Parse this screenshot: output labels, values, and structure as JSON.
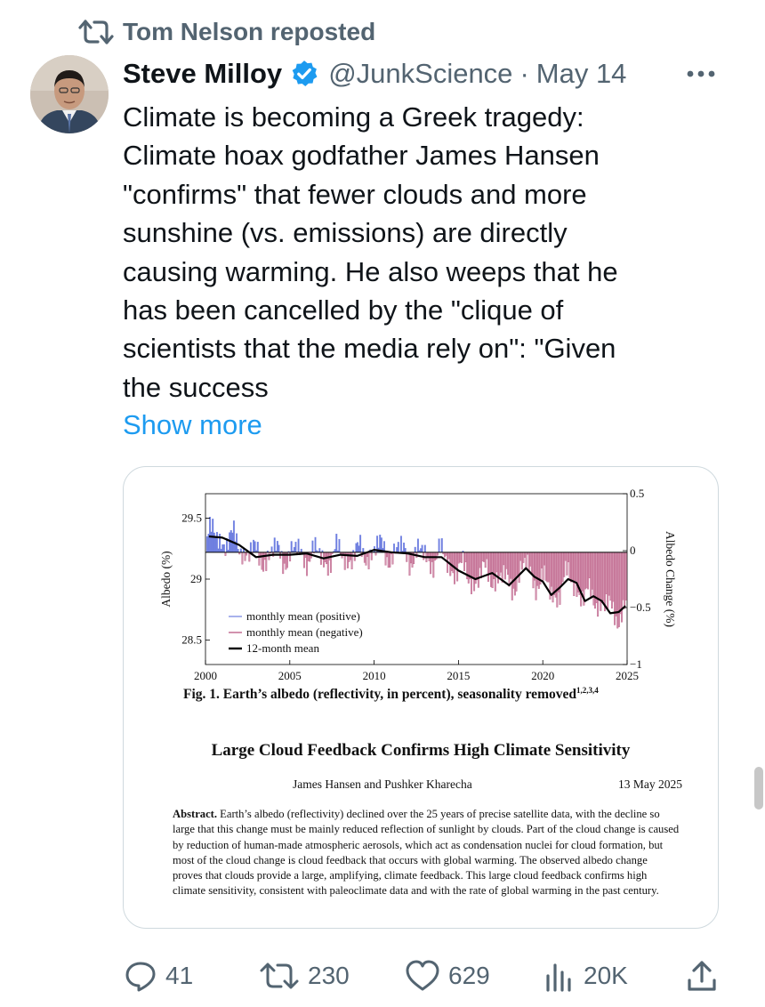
{
  "repost": {
    "text": "Tom Nelson reposted"
  },
  "tweet": {
    "author": {
      "name": "Steve Milloy",
      "handle": "@JunkScience",
      "date": "May 14",
      "verified": true
    },
    "separator": "·",
    "text": "Climate is becoming a Greek tragedy:\nClimate hoax godfather James Hansen\n\"confirms\" that fewer clouds and more\nsunshine (vs. emissions) are directly\ncausing warming. He also weeps that he\nhas been cancelled by the \"clique of\nscientists that the media rely on\": \"Given\nthe success",
    "show_more": "Show more"
  },
  "card": {
    "figure": {
      "caption": "Fig. 1. Earth’s albedo (reflectivity, in percent), seasonality removed",
      "caption_refs": "1,2,3,4"
    },
    "paper": {
      "title": "Large Cloud Feedback Confirms High Climate Sensitivity",
      "authors": "James Hansen and Pushker Kharecha",
      "date": "13 May 2025",
      "abstract_label": "Abstract.",
      "abstract": " Earth’s albedo (reflectivity) declined over the 25 years of precise satellite data, with the decline so large that this change must be mainly reduced reflection of sunlight by clouds. Part of the cloud change is caused by reduction of human-made atmospheric aerosols, which act as condensation nuclei for cloud formation, but most of the cloud change is cloud feedback that occurs with global warming. The observed albedo change proves that clouds provide a large, amplifying, climate feedback. This large cloud feedback confirms high climate sensitivity, consistent with paleoclimate data and with the rate of global warming in the past century."
    }
  },
  "actions": {
    "replies": "41",
    "reposts": "230",
    "likes": "629",
    "views": "20K"
  },
  "colors": {
    "accent": "#1d9bf0",
    "muted": "#536471",
    "positive": "#6f7fe0",
    "negative": "#b34a78",
    "negative_fill": "#d291ad"
  },
  "icons": [
    "repost-icon",
    "verified-badge-icon",
    "more-icon",
    "reply-icon",
    "retweet-icon",
    "like-icon",
    "views-icon",
    "share-icon"
  ],
  "chart_data": {
    "type": "line",
    "ylabel": "Albedo (%)",
    "y2label": "Albedo Change (%)",
    "xlim": [
      2000,
      2025
    ],
    "ylim": [
      28.3,
      29.7
    ],
    "y2lim": [
      -1,
      0.5
    ],
    "xticks": [
      "2000",
      "2005",
      "2010",
      "2015",
      "2020",
      "2025"
    ],
    "yticks": [
      "28.5",
      "29",
      "29.5"
    ],
    "y2ticks": [
      "0.5",
      "0",
      "−0.5",
      "−1"
    ],
    "baseline": 29.22,
    "legend": [
      "monthly mean (positive)",
      "monthly mean (negative)",
      "12-month mean"
    ],
    "legend_position": "bottom-left",
    "series": [
      {
        "name": "12-month mean",
        "x": [
          2000.2,
          2001,
          2002,
          2003,
          2004,
          2005,
          2006,
          2007,
          2008,
          2009,
          2010,
          2011,
          2012,
          2013,
          2014,
          2015,
          2016,
          2017,
          2018,
          2019,
          2019.5,
          2020,
          2020.5,
          2021,
          2021.5,
          2022,
          2022.5,
          2023,
          2023.5,
          2024,
          2024.5,
          2024.9
        ],
        "y": [
          29.35,
          29.34,
          29.28,
          29.18,
          29.2,
          29.2,
          29.21,
          29.17,
          29.2,
          29.19,
          29.24,
          29.22,
          29.21,
          29.18,
          29.18,
          29.07,
          29.0,
          29.05,
          28.95,
          29.09,
          29.02,
          28.98,
          28.87,
          28.93,
          29.0,
          28.97,
          28.82,
          28.86,
          28.82,
          28.72,
          28.73,
          28.78
        ]
      }
    ]
  }
}
